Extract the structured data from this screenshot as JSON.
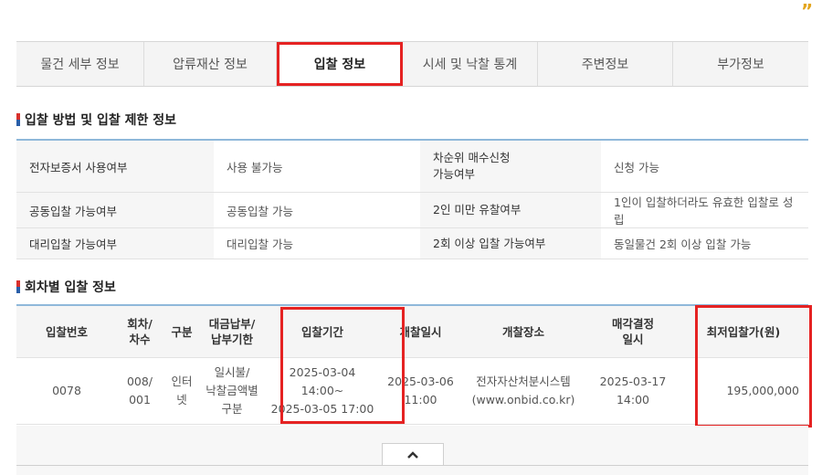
{
  "colors": {
    "highlight": "#e52222",
    "table_rule": "#8fb8da",
    "quote_mark": "#e3a51d"
  },
  "quote_mark": "”",
  "tabs": [
    {
      "label": "물건 세부 정보"
    },
    {
      "label": "압류재산 정보"
    },
    {
      "label": "입찰 정보",
      "active": true
    },
    {
      "label": "시세 및 낙찰 통계"
    },
    {
      "label": "주변정보"
    },
    {
      "label": "부가정보"
    }
  ],
  "section1": {
    "title": "입찰 방법 및 입찰 제한 정보"
  },
  "method_rows": [
    {
      "l1": "전자보증서 사용여부",
      "v1": "사용 불가능",
      "l2": "차순위 매수신청 가능여부",
      "v2": "신청 가능"
    },
    {
      "l1": "공동입찰 가능여부",
      "v1": "공동입찰 가능",
      "l2": "2인 미만 유찰여부",
      "v2": "1인이 입찰하더라도 유효한 입찰로 성립"
    },
    {
      "l1": "대리입찰 가능여부",
      "v1": "대리입찰 가능",
      "l2": "2회 이상 입찰 가능여부",
      "v2": "동일물건 2회 이상 입찰 가능"
    }
  ],
  "section2": {
    "title": "회차별 입찰 정보"
  },
  "round_table": {
    "headers": {
      "bid_no": "입찰번호",
      "round": "회차/\n차수",
      "type": "구분",
      "payment": "대금납부/\n납부기한",
      "period": "입찰기간",
      "opening": "개찰일시",
      "place": "개찰장소",
      "decision": "매각결정\n일시",
      "min_price": "최저입찰가(원)"
    },
    "row": {
      "bid_no": "0078",
      "round": "008/\n001",
      "type": "인터넷",
      "payment": "일시불/\n낙찰금액별\n구분",
      "period": "2025-03-04 14:00~\n2025-03-05 17:00",
      "opening": "2025-03-06\n11:00",
      "place": "전자자산처분시스템\n(www.onbid.co.kr)",
      "decision": "2025-03-17\n14:00",
      "min_price": "195,000,000"
    }
  }
}
